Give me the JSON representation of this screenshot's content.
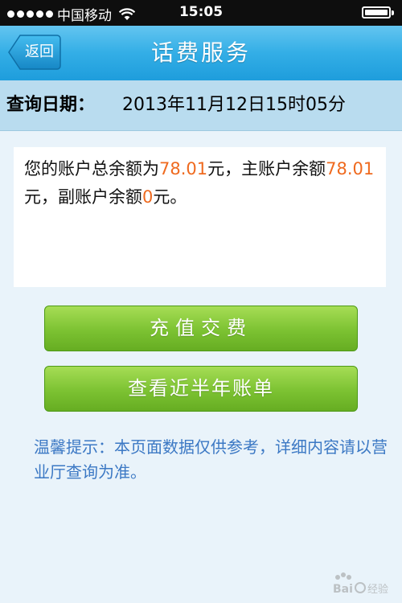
{
  "status_bar": {
    "carrier": "中国移动",
    "time": "15:05",
    "signal_bars": 5,
    "battery_level": 1.0
  },
  "nav": {
    "back_label": "返回",
    "title": "话费服务"
  },
  "query_date": {
    "label": "查询日期：",
    "value": "2013年11月12日15时05分"
  },
  "balance": {
    "text_1": "您的账户总余额为",
    "total": "78.01",
    "text_2": "元，主账户余额",
    "main": "78.01",
    "text_3": "元，副账户余额",
    "sub": "0",
    "text_4": "元。"
  },
  "buttons": {
    "recharge_label": "充值交费",
    "bill_label": "查看近半年账单"
  },
  "tip": "温馨提示：本页面数据仅供参考，详细内容请以营业厅查询为准。",
  "watermark": "Baidu经验",
  "colors": {
    "nav_blue": "#33aee6",
    "highlight_orange": "#ef6a1f",
    "button_green": "#7cc232",
    "tip_blue": "#3b78c4"
  }
}
